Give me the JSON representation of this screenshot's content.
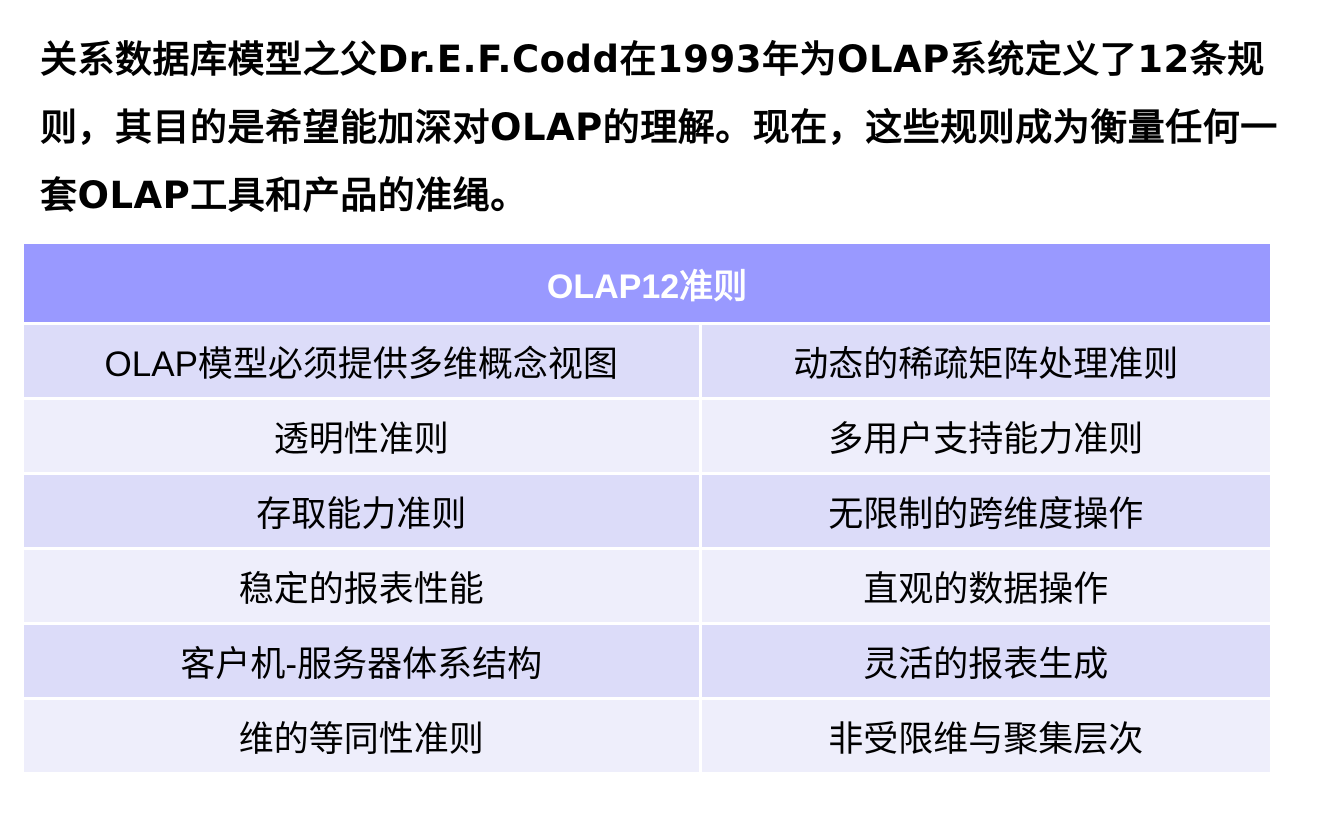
{
  "intro": {
    "text": "关系数据库模型之父Dr.E.F.Codd在1993年为OLAP系统定义了12条规则，其目的是希望能加深对OLAP的理解。现在，这些规则成为衡量任何一套OLAP工具和产品的准绳。"
  },
  "table": {
    "header": "OLAP12准则",
    "colors": {
      "header_bg": "#9999ff",
      "row_odd_bg": "#dcdcf9",
      "row_even_bg": "#eeeefb"
    },
    "rows": [
      [
        "OLAP模型必须提供多维概念视图",
        "动态的稀疏矩阵处理准则"
      ],
      [
        "透明性准则",
        "多用户支持能力准则"
      ],
      [
        "存取能力准则",
        "无限制的跨维度操作"
      ],
      [
        "稳定的报表性能",
        "直观的数据操作"
      ],
      [
        "客户机-服务器体系结构",
        "灵活的报表生成"
      ],
      [
        "维的等同性准则",
        "非受限维与聚集层次"
      ]
    ]
  }
}
